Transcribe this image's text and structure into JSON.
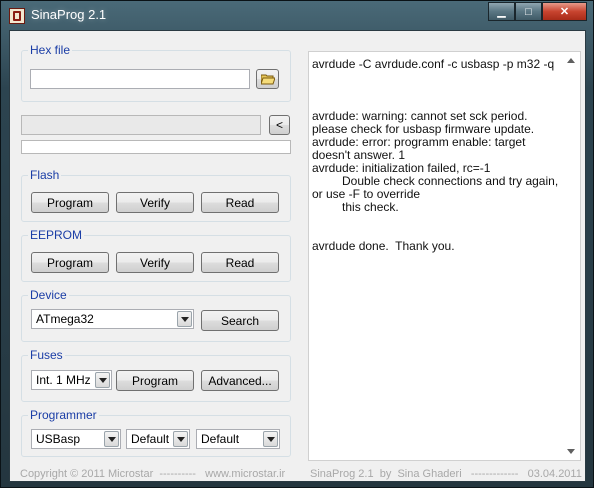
{
  "window": {
    "title": "SinaProg 2.1"
  },
  "hex_file": {
    "legend": "Hex file",
    "value": ""
  },
  "back_button": "<",
  "progress": {
    "percent": 0
  },
  "flash": {
    "legend": "Flash",
    "program": "Program",
    "verify": "Verify",
    "read": "Read"
  },
  "eeprom": {
    "legend": "EEPROM",
    "program": "Program",
    "verify": "Verify",
    "read": "Read"
  },
  "device": {
    "legend": "Device",
    "selected": "ATmega32",
    "search": "Search"
  },
  "fuses": {
    "legend": "Fuses",
    "selected": "Int. 1 MHz",
    "program": "Program",
    "advanced": "Advanced..."
  },
  "programmer": {
    "legend": "Programmer",
    "selected": "USBasp",
    "option2": "Default",
    "option3": "Default"
  },
  "log": {
    "text": "avrdude -C avrdude.conf -c usbasp -p m32 -q\n\n\n\navrdude: warning: cannot set sck period. please check for usbasp firmware update.\navrdude: error: programm enable: target doesn't answer. 1\navrdude: initialization failed, rc=-1\n         Double check connections and try again, or use -F to override\n         this check.\n\n\navrdude done.  Thank you."
  },
  "footer": {
    "left": "Copyright © 2011 Microstar  ----------   www.microstar.ir",
    "right": "SinaProg 2.1  by  Sina Ghaderi   -------------   03.04.2011"
  },
  "colors": {
    "legend": "#1a3da6",
    "footer": "#a8a8a8",
    "progress_fill": "#37b34a"
  }
}
